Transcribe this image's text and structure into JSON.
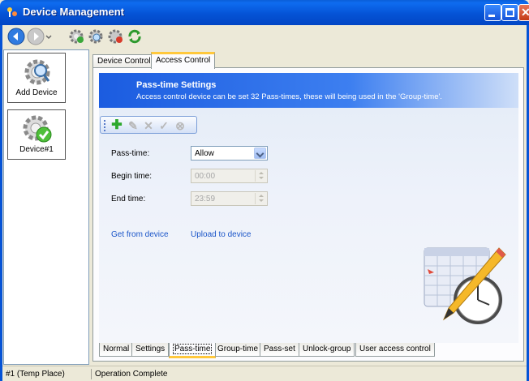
{
  "window": {
    "title": "Device Management",
    "accent": "#0553d6"
  },
  "toolbar": {
    "icons": [
      "back-arrow-icon",
      "forward-arrow-icon",
      "add-device-gear-icon",
      "search-device-gear-icon",
      "delete-device-gear-icon",
      "refresh-icon"
    ]
  },
  "devices": [
    {
      "label": "Add Device",
      "icon": "gear-magnifier-icon"
    },
    {
      "label": "Device#1",
      "icon": "gear-check-icon"
    }
  ],
  "tabs": {
    "top": [
      {
        "label": "Device Control",
        "active": false
      },
      {
        "label": "Access Control",
        "active": true
      }
    ],
    "bottom": [
      {
        "label": "Normal",
        "active": false
      },
      {
        "label": "Settings",
        "active": false
      },
      {
        "label": "Pass-time",
        "active": true
      },
      {
        "label": "Group-time",
        "active": false
      },
      {
        "label": "Pass-set",
        "active": false
      },
      {
        "label": "Unlock-group",
        "active": false
      },
      {
        "label": "User access control",
        "active": false
      }
    ]
  },
  "header": {
    "title": "Pass-time Settings",
    "description": "Access control device can be set 32 Pass-times, these will being used in the 'Group-time'."
  },
  "mini_toolbar": {
    "icons": [
      "add-icon",
      "edit-icon",
      "delete-icon",
      "confirm-icon",
      "cancel-icon"
    ]
  },
  "form": {
    "pass_time": {
      "label": "Pass-time:",
      "value": "Allow"
    },
    "begin_time": {
      "label": "Begin time:",
      "value": "00:00"
    },
    "end_time": {
      "label": "End time:",
      "value": "23:59"
    }
  },
  "links": {
    "get": "Get from device",
    "upload": "Upload to device"
  },
  "status": {
    "place": "#1 (Temp Place)",
    "message": "Operation Complete"
  }
}
